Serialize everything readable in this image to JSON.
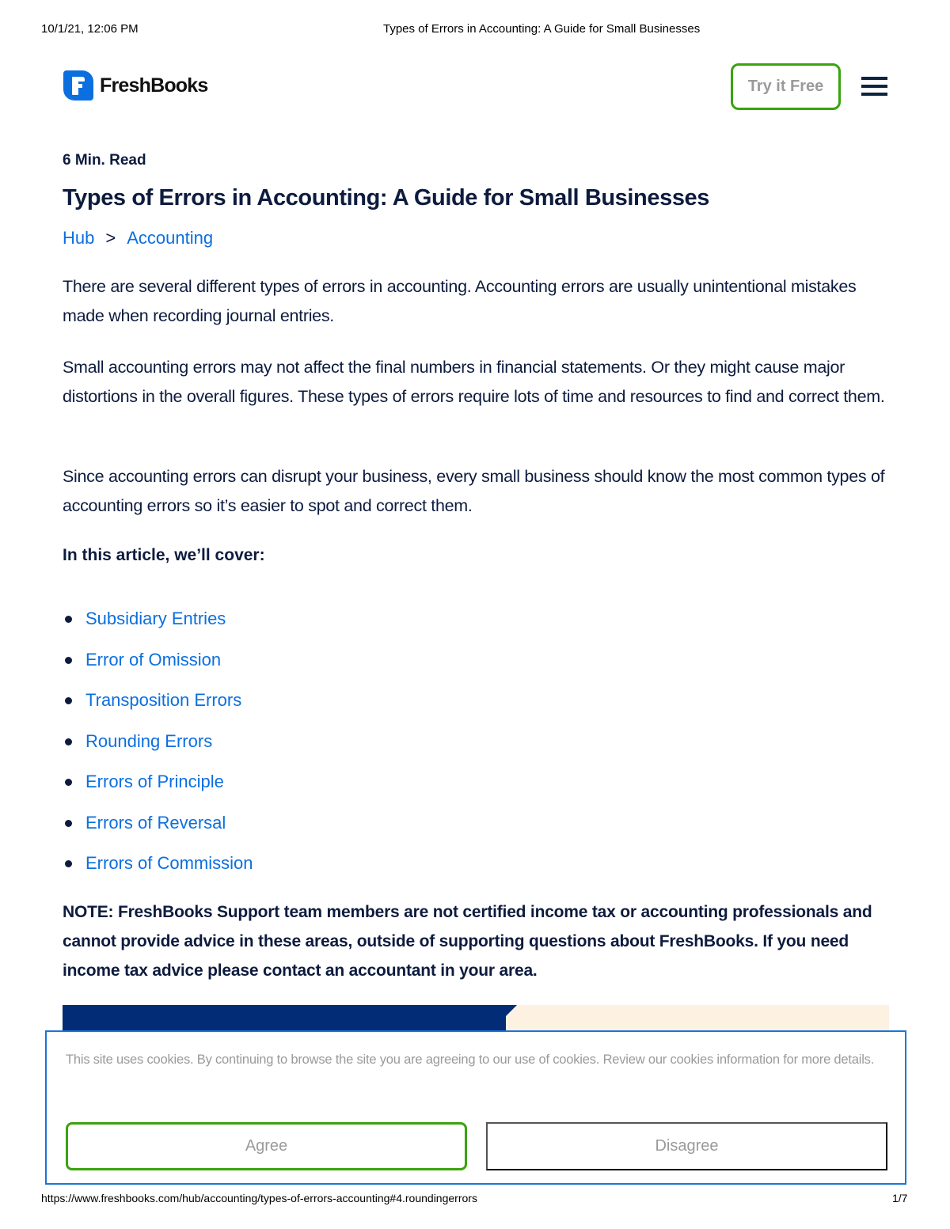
{
  "print_header": {
    "datetime": "10/1/21, 12:06 PM",
    "document_title": "Types of Errors in Accounting: A Guide for Small Businesses"
  },
  "site_header": {
    "logo_text": "FreshBooks",
    "logo_icon": "freshbooks-f-logo",
    "try_free_label": "Try it Free",
    "menu_icon": "hamburger-menu-icon"
  },
  "article": {
    "read_time": "6 Min. Read",
    "title": "Types of Errors in Accounting: A Guide for Small Businesses",
    "breadcrumb": [
      {
        "label": "Hub"
      },
      {
        "label": "Accounting"
      }
    ],
    "breadcrumb_separator": ">",
    "paragraphs": [
      "There are several different types of errors in accounting. Accounting errors are usually unintentional mistakes made when recording journal entries.",
      "Small accounting errors may not affect the final numbers in financial statements. Or they might cause major distortions in the overall figures. These types of errors require lots of time and resources to find and correct them.",
      "Since accounting errors can disrupt your business, every small business should know the most common types of accounting errors so it’s easier to spot and correct them."
    ],
    "cover_heading": "In this article, we’ll cover:",
    "toc": [
      "Subsidiary Entries",
      "Error of Omission",
      "Transposition Errors",
      "Rounding Errors",
      "Errors of Principle",
      "Errors of Reversal",
      "Errors of Commission"
    ],
    "note": "NOTE: FreshBooks Support team members are not certified income tax or accounting professionals and cannot provide advice in these areas, outside of supporting questions about FreshBooks. If you need income tax advice please contact an accountant in your area."
  },
  "cookie_banner": {
    "text": "This site uses cookies. By continuing to browse the site you are agreeing to our use of cookies. Review our cookies information for more details.",
    "agree_label": "Agree",
    "disagree_label": "Disagree"
  },
  "print_footer": {
    "url": "https://www.freshbooks.com/hub/accounting/types-of-errors-accounting#4.roundingerrors",
    "page": "1/7"
  },
  "colors": {
    "brand_blue": "#0b6fe0",
    "navy_text": "#0d1b3e",
    "cta_green": "#3aa30e",
    "banner_navy": "#022c75",
    "banner_cream": "#fdf1e2",
    "cookie_border": "#1a75d8"
  }
}
